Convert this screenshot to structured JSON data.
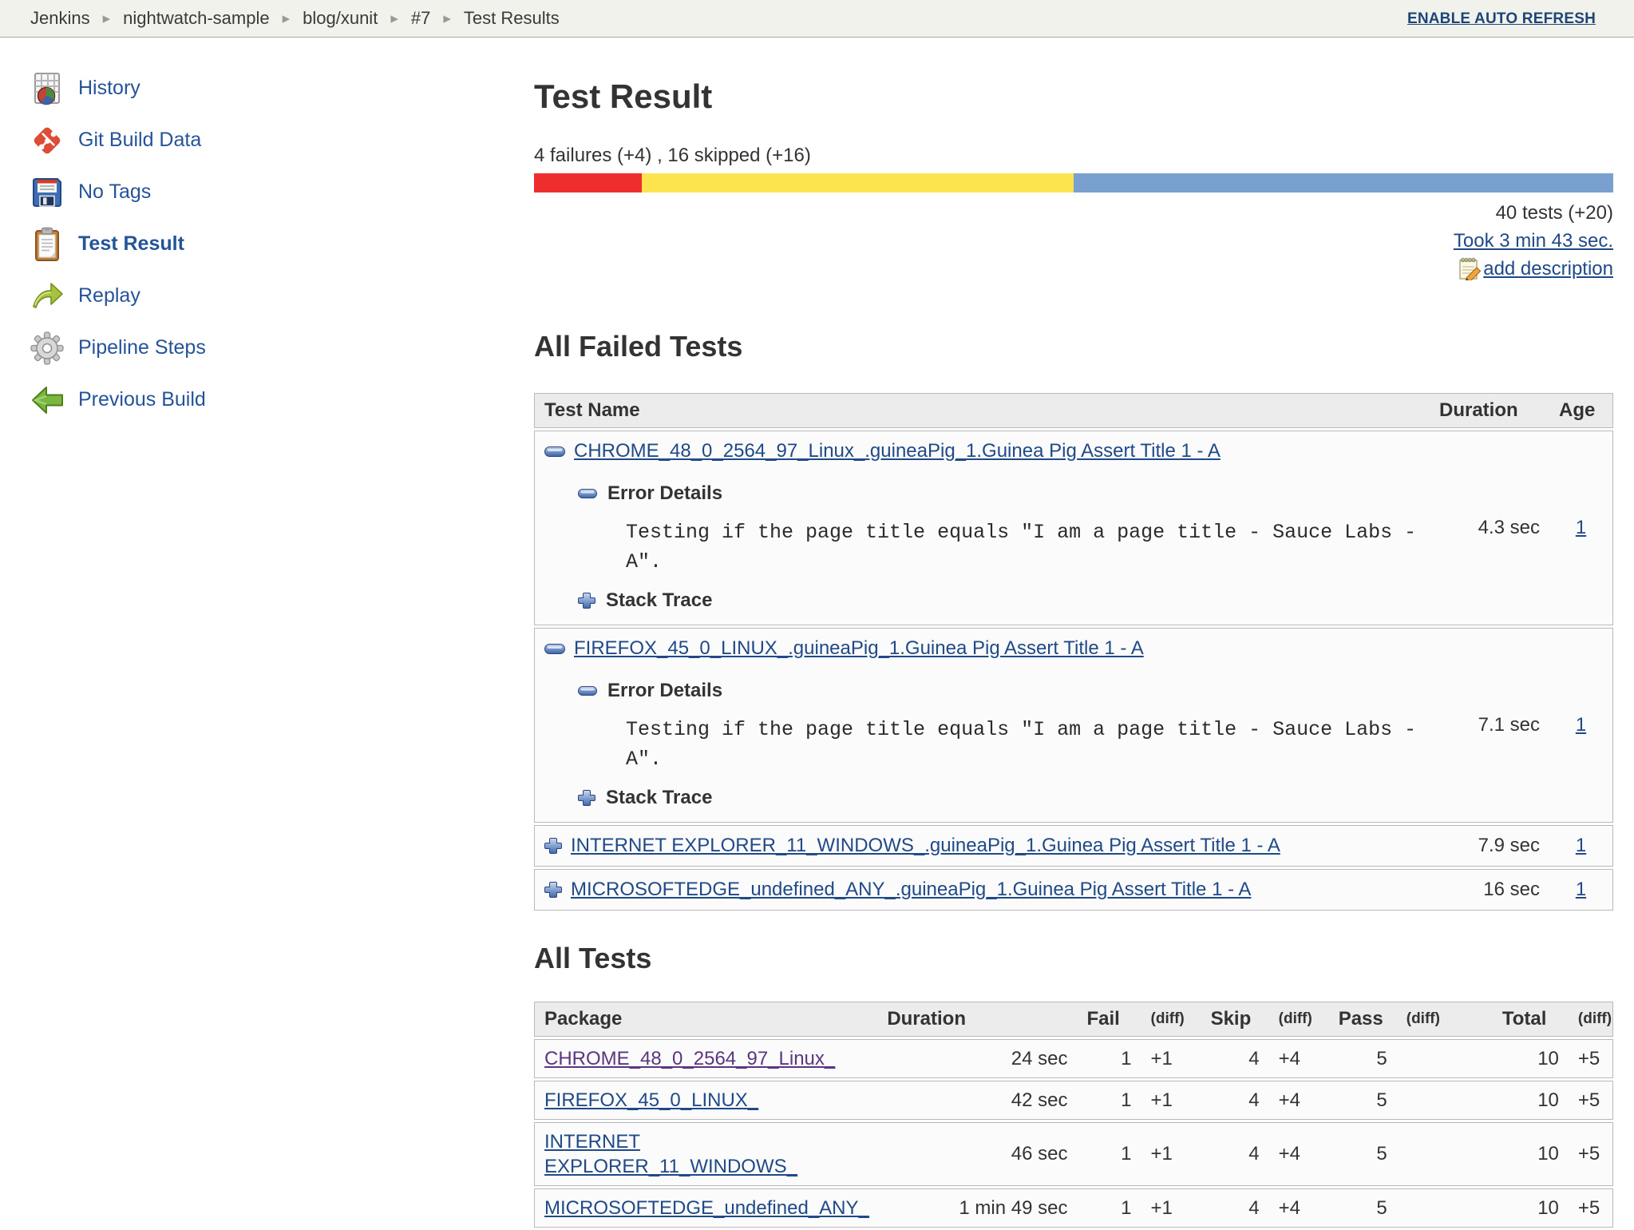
{
  "colors": {
    "failed_red": "#ee2d2d",
    "skipped_yellow": "#fbe44d",
    "passed_blue": "#79a0cf",
    "link_blue": "#204a87",
    "visited_purple": "#5c3580"
  },
  "breadcrumb": {
    "items": [
      "Jenkins",
      "nightwatch-sample",
      "blog/xunit",
      "#7",
      "Test Results"
    ],
    "auto_refresh": "ENABLE AUTO REFRESH"
  },
  "sidebar": {
    "items": [
      {
        "label": "History"
      },
      {
        "label": "Git Build Data"
      },
      {
        "label": "No Tags"
      },
      {
        "label": "Test Result"
      },
      {
        "label": "Replay"
      },
      {
        "label": "Pipeline Steps"
      },
      {
        "label": "Previous Build"
      }
    ]
  },
  "summary": {
    "title": "Test Result",
    "failure_line": "4 failures (+4) , 16 skipped (+16)",
    "bar": {
      "failed_width": "10%",
      "skipped_width": "40%",
      "passed_width": "50%"
    },
    "total_tests": "40 tests (+20)",
    "took": "Took 3 min 43 sec.",
    "add_description": "add description"
  },
  "failed_tests": {
    "heading": "All Failed Tests",
    "columns": {
      "name": "Test Name",
      "duration": "Duration",
      "age": "Age"
    },
    "error_details_label": "Error Details",
    "stack_trace_label": "Stack Trace",
    "rows": [
      {
        "name": "CHROME_48_0_2564_97_Linux_.guineaPig_1.Guinea Pig Assert Title 1 - A",
        "expanded": true,
        "error_text": "Testing if the page title equals \"I am a page title - Sauce Labs - A\".",
        "duration": "4.3 sec",
        "age": "1"
      },
      {
        "name": "FIREFOX_45_0_LINUX_.guineaPig_1.Guinea Pig Assert Title 1 - A",
        "expanded": true,
        "error_text": "Testing if the page title equals \"I am a page title - Sauce Labs - A\".",
        "duration": "7.1 sec",
        "age": "1"
      },
      {
        "name": "INTERNET EXPLORER_11_WINDOWS_.guineaPig_1.Guinea Pig Assert Title 1 - A",
        "expanded": false,
        "duration": "7.9 sec",
        "age": "1"
      },
      {
        "name": "MICROSOFTEDGE_undefined_ANY_.guineaPig_1.Guinea Pig Assert Title 1 - A",
        "expanded": false,
        "duration": "16 sec",
        "age": "1"
      }
    ]
  },
  "all_tests": {
    "heading": "All Tests",
    "columns": [
      "Package",
      "Duration",
      "Fail",
      "(diff)",
      "Skip",
      "(diff)",
      "Pass",
      "(diff)",
      "Total",
      "(diff)"
    ],
    "rows": [
      {
        "package": "CHROME_48_0_2564_97_Linux_",
        "duration": "24 sec",
        "fail": "1",
        "fail_diff": "+1",
        "skip": "4",
        "skip_diff": "+4",
        "pass": "5",
        "pass_diff": "",
        "total": "10",
        "total_diff": "+5"
      },
      {
        "package": "FIREFOX_45_0_LINUX_",
        "duration": "42 sec",
        "fail": "1",
        "fail_diff": "+1",
        "skip": "4",
        "skip_diff": "+4",
        "pass": "5",
        "pass_diff": "",
        "total": "10",
        "total_diff": "+5"
      },
      {
        "package": "INTERNET EXPLORER_11_WINDOWS_",
        "duration": "46 sec",
        "fail": "1",
        "fail_diff": "+1",
        "skip": "4",
        "skip_diff": "+4",
        "pass": "5",
        "pass_diff": "",
        "total": "10",
        "total_diff": "+5"
      },
      {
        "package": "MICROSOFTEDGE_undefined_ANY_",
        "duration": "1 min 49 sec",
        "fail": "1",
        "fail_diff": "+1",
        "skip": "4",
        "skip_diff": "+4",
        "pass": "5",
        "pass_diff": "",
        "total": "10",
        "total_diff": "+5"
      }
    ]
  }
}
